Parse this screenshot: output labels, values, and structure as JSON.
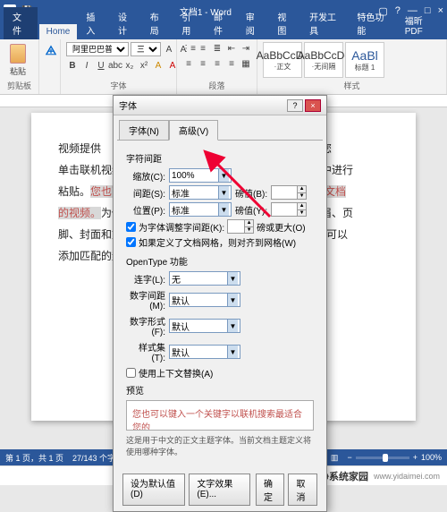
{
  "title_bar": {
    "app_icon": "W",
    "doc_title": "文档1 - Word"
  },
  "win_controls": {
    "help": "?",
    "min": "—",
    "max": "□",
    "close": "×",
    "ropt": "▢"
  },
  "ribbon_tabs": {
    "file": "文件",
    "items": [
      "Home",
      "插入",
      "设计",
      "布局",
      "引用",
      "邮件",
      "审阅",
      "视图",
      "开发工具",
      "特色功能",
      "福昕PDF"
    ]
  },
  "ribbon": {
    "clipboard": {
      "paste": "粘贴",
      "label": "剪贴板"
    },
    "font": {
      "name": "阿里巴巴普...",
      "size": "三号",
      "label": "字体"
    },
    "para": {
      "label": "段落"
    },
    "styles": {
      "s1": {
        "sample": "AaBbCcDc",
        "name": "·正文"
      },
      "s2": {
        "sample": "AaBbCcDc",
        "name": "·无间隔"
      },
      "s3": {
        "sample": "AaBl",
        "name": "标题 1"
      },
      "label": "样式"
    }
  },
  "document": {
    "line1_a": "    视频提供",
    "line1_b": "的观点。当您",
    "line2_a": "单击联机视频",
    "line2_b": "入代码中进行",
    "line3_a": "粘贴。",
    "line3_hl": "您也可",
    "line3_b": "",
    "line3_hl2": "适合您的文档",
    "line4_hl": "的视频。",
    "line4_a": "为使",
    "line4_b": "供了页眉、页",
    "line5_a": "脚、封面和文",
    "line5_b": "如，您可以",
    "line6_a": "添加匹配的封"
  },
  "dialog": {
    "title": "字体",
    "tabs": {
      "t1": "字体(N)",
      "t2": "高级(V)"
    },
    "section_spacing": "字符间距",
    "scale": {
      "label": "缩放(C):",
      "value": "100%"
    },
    "spacing": {
      "label": "间距(S):",
      "value": "标准",
      "by_label": "磅值(B):"
    },
    "position": {
      "label": "位置(P):",
      "value": "标准",
      "by_label": "磅值(Y):"
    },
    "kerning": {
      "cb": "为字体调整字间距(K):",
      "unit": "磅或更大(O)"
    },
    "grid_cb": "如果定义了文档网格，则对齐到网格(W)",
    "section_ot": "OpenType 功能",
    "ligatures": {
      "label": "连字(L):",
      "value": "无"
    },
    "numspacing": {
      "label": "数字间距(M):",
      "value": "默认"
    },
    "numforms": {
      "label": "数字形式(F):",
      "value": "默认"
    },
    "stylistic": {
      "label": "样式集(T):",
      "value": "默认"
    },
    "context_cb": "使用上下文替换(A)",
    "preview_label": "预览",
    "preview_text": "您也可以键入一个关键字以联机搜索最适合您的",
    "hint": "这是用于中文的正文主题字体。当前文档主题定义将使用哪种字体。",
    "btn_default": "设为默认值(D)",
    "btn_effects": "文字效果(E)...",
    "btn_ok": "确定",
    "btn_cancel": "取消"
  },
  "status": {
    "page": "第 1 页，共 1 页",
    "words": "27/143 个字",
    "lang": "中文(中国)",
    "zoom": "100%"
  },
  "watermark": {
    "text": "纯净系统家园",
    "url": "www.yidaimei.com"
  }
}
